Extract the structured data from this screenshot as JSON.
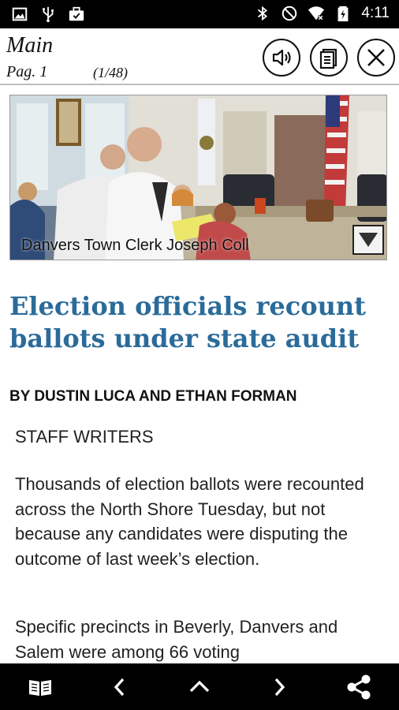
{
  "status_bar": {
    "time": "4:11",
    "left_icons": [
      "image-icon",
      "usb-icon",
      "briefcase-icon"
    ],
    "right_icons": [
      "bluetooth-icon",
      "do-not-disturb-icon",
      "wifi-icon",
      "battery-icon"
    ]
  },
  "header": {
    "section": "Main",
    "page_label": "Pag. 1",
    "page_count": "(1/48)",
    "buttons": [
      "speaker-icon",
      "clipboard-icon",
      "close-icon"
    ]
  },
  "photo": {
    "caption": "Danvers Town Clerk Joseph Coll"
  },
  "article": {
    "headline": "Election officials recount ballots under state audit",
    "byline": "BY DUSTIN LUCA AND ETHAN FORMAN",
    "staff": "STAFF WRITERS",
    "paragraph_1": "Thousands of election ballots were recounted across the North Shore Tuesday, but not because any candidates were disputing the outcome of last week’s election.",
    "paragraph_2": "Specific precincts in Beverly, Danvers and Salem were among 66 voting"
  },
  "bottom_nav": [
    "book-icon",
    "chevron-left-icon",
    "chevron-up-icon",
    "chevron-right-icon",
    "share-icon"
  ],
  "colors": {
    "headline": "#2a6b9a",
    "status_bar": "#000000",
    "nav_bar": "#000000"
  }
}
